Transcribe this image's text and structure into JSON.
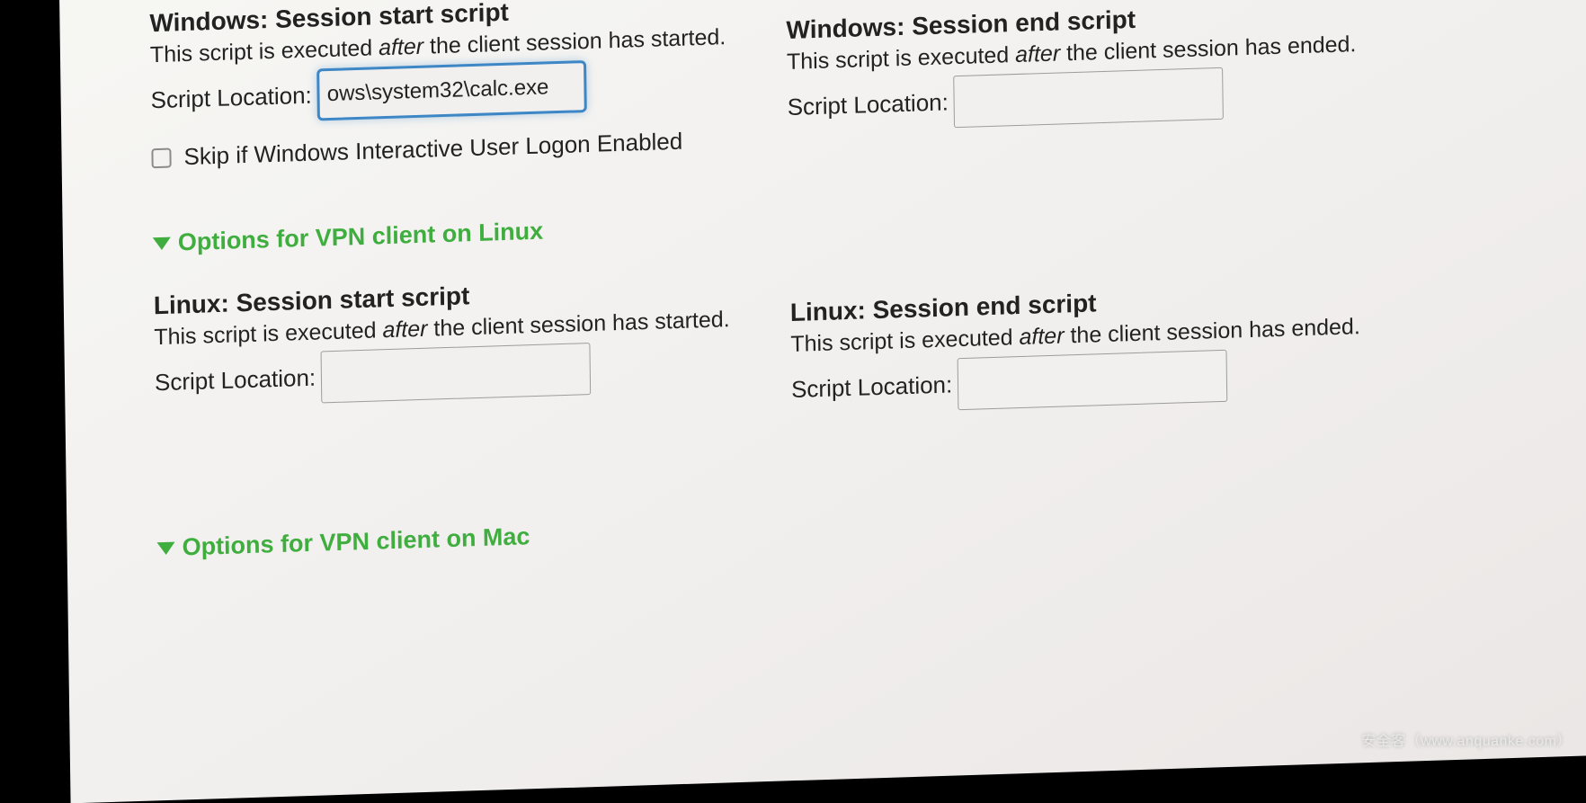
{
  "windows": {
    "start": {
      "heading": "Windows: Session start script",
      "desc_a": "This script is executed ",
      "desc_after": "after",
      "desc_b": " the client session has started.",
      "loc_label": "Script Location:",
      "value": "ows\\system32\\calc.exe"
    },
    "end": {
      "heading": "Windows: Session end script",
      "desc_a": "This script is executed ",
      "desc_after": "after",
      "desc_b": " the client session has ended.",
      "loc_label": "Script Location:",
      "value": ""
    },
    "skip_label": "Skip if Windows Interactive User Logon Enabled"
  },
  "toggles": {
    "linux": "Options for VPN client on Linux",
    "mac": "Options for VPN client on Mac"
  },
  "linux": {
    "start": {
      "heading": "Linux: Session start script",
      "desc_a": "This script is executed ",
      "desc_after": "after",
      "desc_b": " the client session has started.",
      "loc_label": "Script Location:",
      "value": ""
    },
    "end": {
      "heading": "Linux: Session end script",
      "desc_a": "This script is executed ",
      "desc_after": "after",
      "desc_b": " the client session has ended.",
      "loc_label": "Script Location:",
      "value": ""
    }
  },
  "watermark": "安全客（www.anquanke.com）"
}
